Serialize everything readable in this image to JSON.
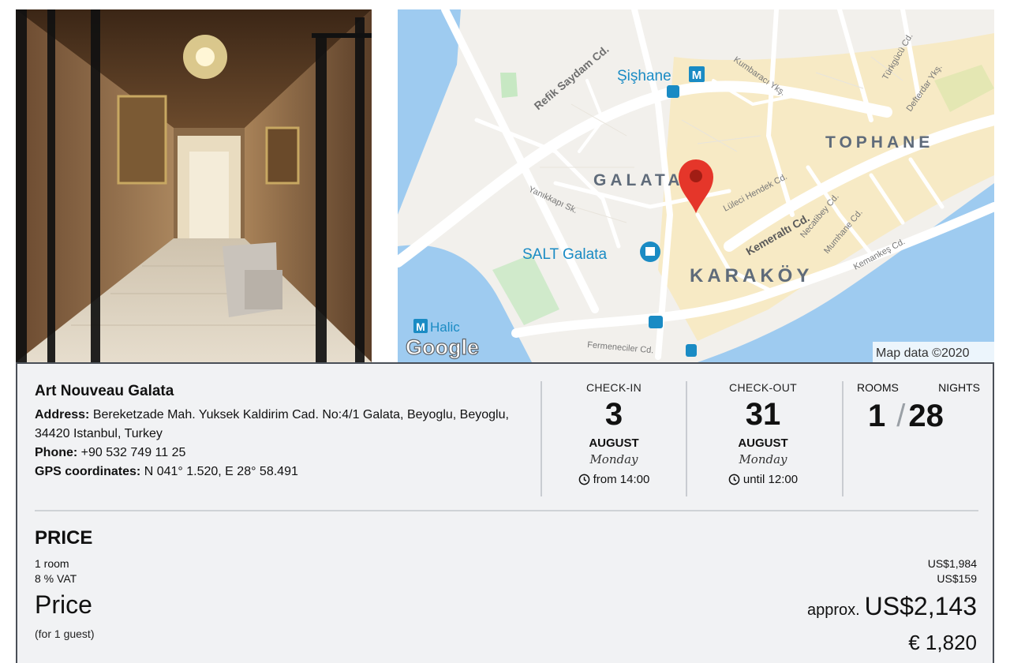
{
  "map": {
    "streets": [
      "Refik Saydam Cd.",
      "Kumbaracı Ykş.",
      "Türkgücü Cd.",
      "Defterdar Ykş.",
      "Yanıkkapı Sk.",
      "Lüleci Hendek Cd.",
      "Kemeraltı Cd.",
      "Necatibey Cd.",
      "Mumhane Cd.",
      "Kemankeş Cd.",
      "Fermeneciler Cd."
    ],
    "districts": [
      "GALATA",
      "TOPHANE",
      "KARAKÖY"
    ],
    "places": [
      "Şişhane",
      "SALT Galata",
      "Halic"
    ],
    "metro_badge": "M",
    "logo": "Google",
    "attribution": "Map data ©2020",
    "colors": {
      "water": "#9ecbf0",
      "land": "#f2f0ec",
      "road": "#ffffff",
      "highway": "#fde9a8",
      "park": "#c7e8c3",
      "pin": "#e5362a"
    }
  },
  "hotel": {
    "name": "Art Nouveau Galata",
    "address_label": "Address:",
    "address": "Bereketzade Mah. Yuksek Kaldirim Cad. No:4/1 Galata, Beyoglu, Beyoglu, 34420 Istanbul, Turkey",
    "phone_label": "Phone:",
    "phone": "+90 532 749 11 25",
    "gps_label": "GPS coordinates:",
    "gps": "N 041° 1.520, E 28° 58.491"
  },
  "checkin": {
    "label": "CHECK-IN",
    "day_num": "3",
    "month": "AUGUST",
    "weekday": "Monday",
    "time": "from 14:00"
  },
  "checkout": {
    "label": "CHECK-OUT",
    "day_num": "31",
    "month": "AUGUST",
    "weekday": "Monday",
    "time": "until 12:00"
  },
  "stay": {
    "rooms_label": "ROOMS",
    "nights_label": "NIGHTS",
    "rooms": "1",
    "separator": "/",
    "nights": "28"
  },
  "price": {
    "heading": "PRICE",
    "room_line": "1 room",
    "room_amount": "US$1,984",
    "vat_line": "8 % VAT",
    "vat_amount": "US$159",
    "label": "Price",
    "guests": "(for 1 guest)",
    "approx_prefix": "approx.",
    "total": "US$2,143",
    "total_eur": "€ 1,820"
  }
}
